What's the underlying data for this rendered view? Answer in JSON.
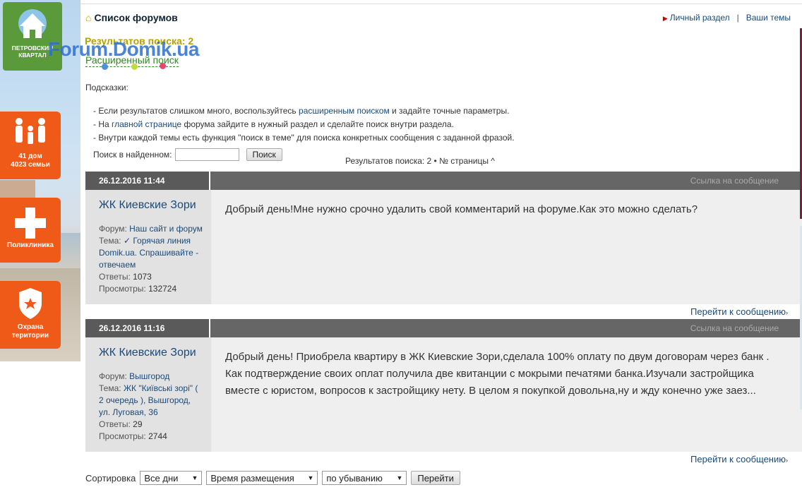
{
  "banner": {
    "logo_line1": "ПЕТРОВСКИЙ",
    "logo_line2": "КВАРТАЛ",
    "tile1_line1": "41 дом",
    "tile1_line2": "4023 семьи",
    "tile2": "Поликлиника",
    "tile3_line1": "Охрана",
    "tile3_line2": "територии"
  },
  "header": {
    "breadcrumb": "Список форумов",
    "link_personal": "Личный раздел",
    "link_topics": "Ваши темы"
  },
  "search": {
    "results_title": "Результатов поиска: 2",
    "watermark": "Forum.Domik.ua",
    "advanced": "Расширенный поиск",
    "hints_label": "Подсказки:",
    "hint1_pre": "- Если результатов слишком много, воспользуйтесь ",
    "hint1_link": "расширенным поиском",
    "hint1_post": " и задайте точные параметры.",
    "hint2_pre": "- На ",
    "hint2_link": "главной странице",
    "hint2_post": " форума зайдите в нужный раздел и сделайте поиск внутри раздела.",
    "hint3": "- Внутри каждой темы есть функция \"поиск в теме\" для поиска конкретных сообщения с заданной фразой.",
    "find_label": "Поиск в найденном:",
    "find_value": "",
    "find_button": "Поиск",
    "pager": "Результатов поиска: 2 • № страницы ^"
  },
  "posts": [
    {
      "date": "26.12.2016 11:44",
      "permalink": "Ссылка на сообщение",
      "author": "ЖК Киевские Зори",
      "forum_label": "Форум:",
      "forum": "Наш сайт и форум",
      "topic_label": "Тема:",
      "topic": "✓ Горячая линия Domik.ua. Спрашивайте - отвечаем",
      "replies_label": "Ответы:",
      "replies": "1073",
      "views_label": "Просмотры:",
      "views": "132724",
      "text": "Добрый день!Мне нужно срочно удалить свой комментарий на форуме.Как это можно сделать?",
      "goto": "Перейти к сообщению"
    },
    {
      "date": "26.12.2016 11:16",
      "permalink": "Ссылка на сообщение",
      "author": "ЖК Киевские Зори",
      "forum_label": "Форум:",
      "forum": "Вышгород",
      "topic_label": "Тема:",
      "topic": "ЖК \"Київські зорі\" ( 2 очередь ), Вышгород, ул. Луговая, 36",
      "replies_label": "Ответы:",
      "replies": "29",
      "views_label": "Просмотры:",
      "views": "2744",
      "text": "Добрый день! Приобрела квартиру в ЖК Киевские Зори,сделала 100% оплату по двум договорам через банк . Как подтверждение своих оплат получила две квитанции с мокрыми печатями банка.Изучали застройщика вместе с юристом, вопросов к застройщику нету. В целом я покупкой довольна,ну и жду конечно уже заез...",
      "goto": "Перейти к сообщению"
    }
  ],
  "sort": {
    "label": "Сортировка",
    "days": "Все дни",
    "field": "Время размещения",
    "order": "по убыванию",
    "button": "Перейти"
  }
}
